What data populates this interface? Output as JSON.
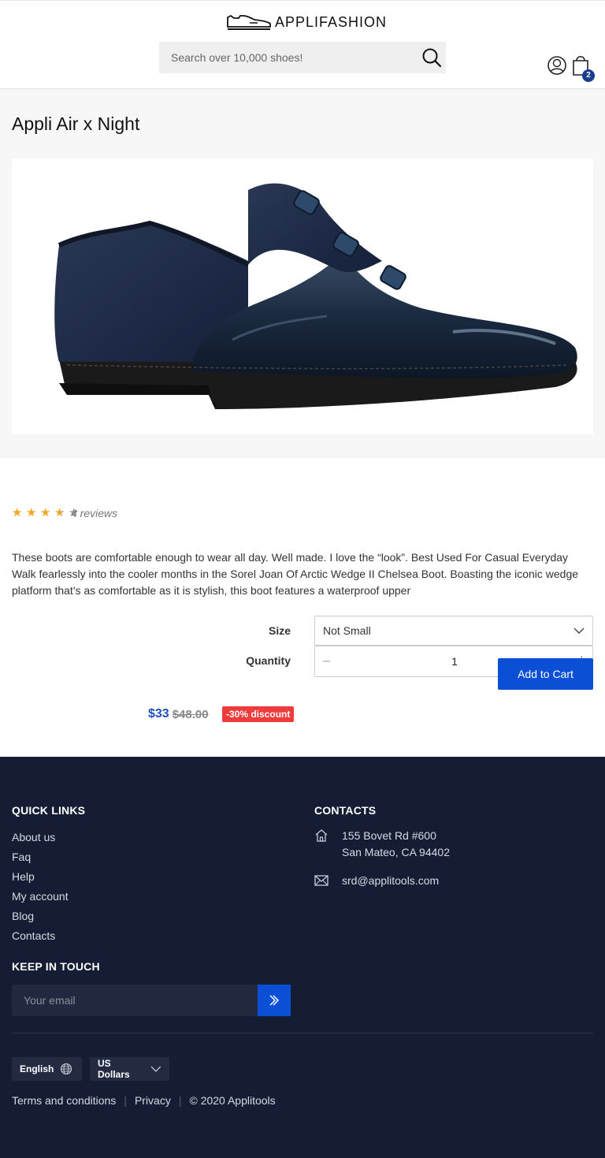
{
  "header": {
    "brand": "APPLIFASHION",
    "search_placeholder": "Search over 10,000 shoes!",
    "cart_count": "2"
  },
  "product": {
    "title": "Appli Air x Night",
    "rating": {
      "value": 3.5,
      "max": 5
    },
    "reviews_label": "4 reviews",
    "description": "These boots are comfortable enough to wear all day. Well made. I love the “look”. Best Used For Casual Everyday Walk fearlessly into the cooler months in the Sorel Joan Of Arctic Wedge II Chelsea Boot. Boasting the iconic wedge platform that's as comfortable as it is stylish, this boot features a waterproof upper",
    "size_label": "Size",
    "size_value": "Not Small",
    "quantity_label": "Quantity",
    "quantity_minus": "–",
    "quantity_value": "1",
    "quantity_plus": "+",
    "add_to_cart": "Add to Cart",
    "price_now": "$33",
    "price_old": "$48.00",
    "discount": "-30% discount"
  },
  "footer": {
    "quick_links_title": "QUICK LINKS",
    "quick_links": [
      "About us",
      "Faq",
      "Help",
      "My account",
      "Blog",
      "Contacts"
    ],
    "contacts_title": "CONTACTS",
    "address_line1": "155 Bovet Rd #600",
    "address_line2": "San Mateo, CA 94402",
    "email": "srd@applitools.com",
    "keep_in_touch_title": "KEEP IN TOUCH",
    "email_placeholder": "Your email",
    "language": "English",
    "currency": "US Dollars",
    "terms": "Terms and conditions",
    "privacy": "Privacy",
    "copyright": "© 2020 Applitools"
  },
  "colors": {
    "accent": "#0b4fd6",
    "footer_bg": "#141d33",
    "discount_bg": "#ef3b3b",
    "star": "#f5a623",
    "price": "#1f4fbf"
  },
  "icons": [
    "shoe-logo-icon",
    "search-icon",
    "user-icon",
    "cart-icon",
    "star-icon",
    "chevron-down-icon",
    "home-icon",
    "mail-icon",
    "double-chevron-right-icon",
    "globe-icon"
  ]
}
